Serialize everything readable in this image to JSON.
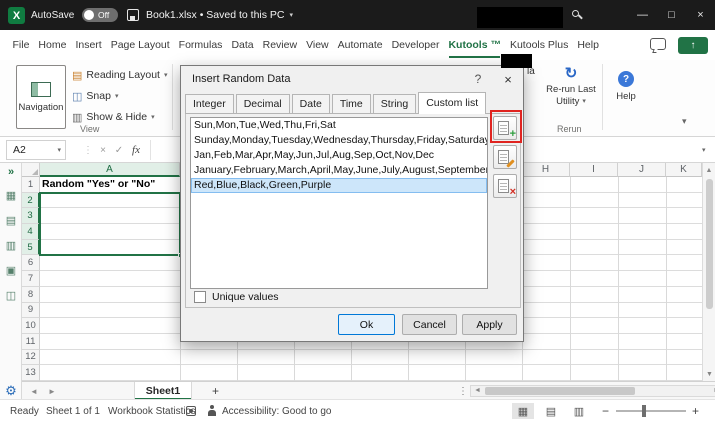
{
  "title_bar": {
    "autosave_label": "AutoSave",
    "autosave_state": "Off",
    "document_title": "Book1.xlsx • Saved to this PC"
  },
  "ribbon_tabs": [
    "File",
    "Home",
    "Insert",
    "Page Layout",
    "Formulas",
    "Data",
    "Review",
    "View",
    "Automate",
    "Developer",
    "Kutools ™",
    "Kutools Plus",
    "Help"
  ],
  "active_ribbon_tab": "Kutools ™",
  "ribbon": {
    "navigation_label": "Navigation",
    "reading_layout_label": "Reading Layout",
    "snap_label": "Snap",
    "show_hide_label": "Show & Hide",
    "view_group_label": "View",
    "clipped_label": "la",
    "rerun_label_line1": "Re-run Last",
    "rerun_label_line2": "Utility",
    "rerun_group_label": "Rerun",
    "help_label": "Help"
  },
  "formula_bar": {
    "name_box_value": "A2",
    "fx_label": "fx",
    "formula_value": ""
  },
  "sheet": {
    "column_a_header": "A",
    "right_column_headers": [
      "H",
      "I",
      "J",
      "K"
    ],
    "row_numbers": [
      "1",
      "2",
      "3",
      "4",
      "5",
      "6",
      "7",
      "8",
      "9",
      "10",
      "11",
      "12",
      "13"
    ],
    "a1_value": "Random \"Yes\" or \"No\""
  },
  "dialog": {
    "title": "Insert Random Data",
    "tabs": [
      "Integer",
      "Decimal",
      "Date",
      "Time",
      "String",
      "Custom list"
    ],
    "active_tab": "Custom list",
    "list_items": [
      "Sun,Mon,Tue,Wed,Thu,Fri,Sat",
      "Sunday,Monday,Tuesday,Wednesday,Thursday,Friday,Saturday",
      "Jan,Feb,Mar,Apr,May,Jun,Jul,Aug,Sep,Oct,Nov,Dec",
      "January,February,March,April,May,June,July,August,September,Octob...",
      "Red,Blue,Black,Green,Purple"
    ],
    "selected_item": "Red,Blue,Black,Green,Purple",
    "unique_values_label": "Unique values",
    "ok_label": "Ok",
    "cancel_label": "Cancel",
    "apply_label": "Apply"
  },
  "sheet_tabs": {
    "active_tab": "Sheet1"
  },
  "status_bar": {
    "ready_label": "Ready",
    "sheet_info": "Sheet 1 of 1",
    "workbook_stats_label": "Workbook Statistics",
    "accessibility_label": "Accessibility: Good to go"
  },
  "icons": {
    "excel_logo": "X",
    "caret_down": "▾",
    "minimize": "—",
    "maximize": "□",
    "close": "×",
    "share_arrow": "↑",
    "reading_layout": "▤",
    "snap": "◫",
    "show_hide": "▥",
    "rerun": "↻",
    "help_q": "?",
    "cancel_x": "×",
    "check": "✓",
    "double_chevron": "»",
    "pane_1": "▦",
    "pane_2": "▤",
    "pane_3": "▥",
    "pane_4": "▣",
    "pane_5": "◫",
    "gear": "⚙",
    "scroll_up": "▲",
    "scroll_down": "▼",
    "scroll_left": "◄",
    "scroll_right": "►",
    "plus": "+",
    "dots": "⋮",
    "view_normal": "▦",
    "view_layout": "▤",
    "view_break": "▥",
    "zoom_minus": "−",
    "zoom_plus": "+",
    "dialog_help": "?",
    "collapse_ribbon": "▾"
  },
  "colors": {
    "excel_green": "#217346",
    "accent_blue": "#0078d7",
    "annotation_red": "#e02420",
    "list_selection_blue": "#cde6fa",
    "titlebar_bg": "#1b1b1b"
  }
}
